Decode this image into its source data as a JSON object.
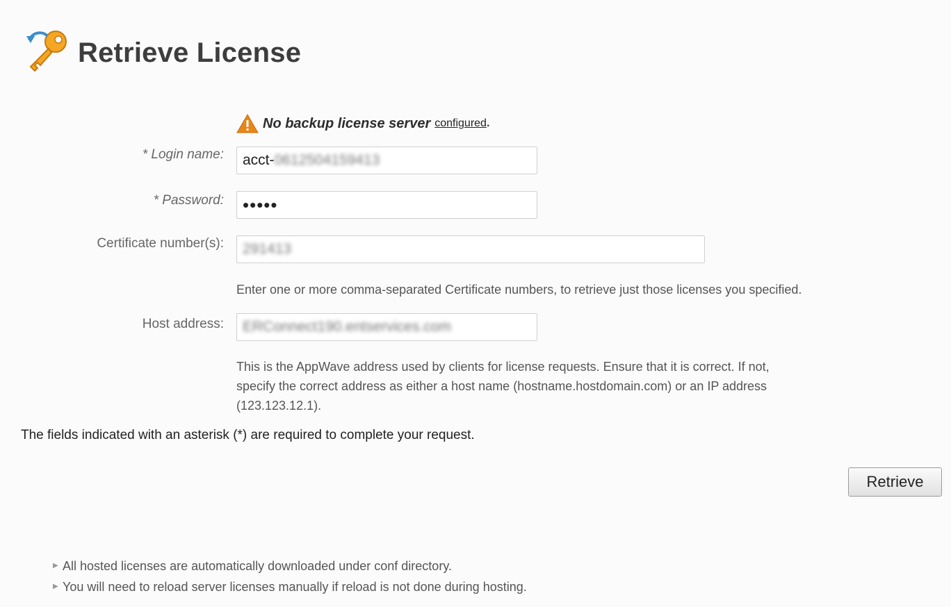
{
  "header": {
    "title": "Retrieve License",
    "icon": "key-icon"
  },
  "warning": {
    "icon": "warning-triangle-icon",
    "text": "No backup license server",
    "link_text": "configured",
    "suffix": "."
  },
  "form": {
    "login_label": "* Login name:",
    "login_value": "acct-",
    "login_obscured": "0612504159413",
    "password_label": "* Password:",
    "password_value": "•••••",
    "cert_label": "Certificate number(s):",
    "cert_value": "291413",
    "cert_help": "Enter one or more comma-separated Certificate numbers, to retrieve just those licenses you specified.",
    "host_label": "Host address:",
    "host_value": "ERConnect190.entservices.com",
    "host_help_1": "This is the AppWave address used by clients for license requests. Ensure that it is correct. If not,",
    "host_help_2": "specify the correct address as either a host name (hostname.hostdomain.com) or an IP address",
    "host_help_3": "(123.123.12.1)."
  },
  "required_note": "The fields indicated with an asterisk (*) are required to complete your request.",
  "actions": {
    "retrieve_label": "Retrieve"
  },
  "notes": [
    "All hosted licenses are automatically downloaded under conf directory.",
    "You will need to reload server licenses manually if reload is not done during hosting."
  ],
  "colors": {
    "accent_orange": "#f0a030",
    "warning": "#e8861a"
  }
}
